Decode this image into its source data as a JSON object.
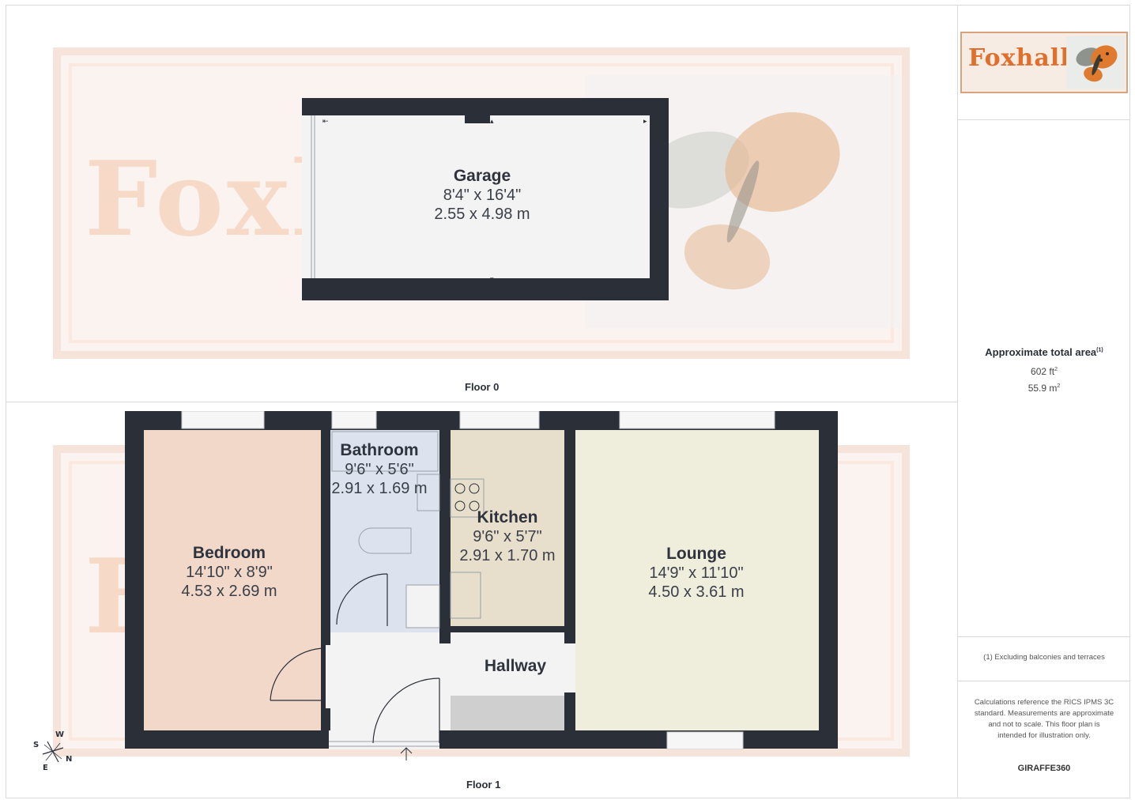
{
  "brand": {
    "logo_text": "Foxhall",
    "watermark_text": "Foxhall",
    "vendor": "GIRAFFE360"
  },
  "colors": {
    "wall": "#2b2f38",
    "bedroom": "#f1d8c8",
    "bathroom": "#dce3ef",
    "kitchen": "#e7dfcb",
    "lounge": "#efeedd",
    "hallway": "#f3f3f3",
    "garage": "#f3f3f3",
    "brand_orange": "#e26e2b"
  },
  "floors": [
    {
      "label": "Floor 0",
      "rooms": [
        {
          "name": "Garage",
          "dim_imperial": "8'4\" x 16'4\"",
          "dim_metric": "2.55 x 4.98 m"
        }
      ]
    },
    {
      "label": "Floor 1",
      "rooms": [
        {
          "name": "Bedroom",
          "dim_imperial": "14'10\" x 8'9\"",
          "dim_metric": "4.53 x 2.69 m"
        },
        {
          "name": "Bathroom",
          "dim_imperial": "9'6\" x 5'6\"",
          "dim_metric": "2.91 x 1.69 m"
        },
        {
          "name": "Kitchen",
          "dim_imperial": "9'6\" x 5'7\"",
          "dim_metric": "2.91 x 1.70 m"
        },
        {
          "name": "Lounge",
          "dim_imperial": "14'9\" x 11'10\"",
          "dim_metric": "4.50 x 3.61 m"
        },
        {
          "name": "Hallway"
        }
      ],
      "compass": {
        "w": "W",
        "s": "S",
        "e": "E",
        "n": "N"
      }
    }
  ],
  "summary": {
    "title": "Approximate total area",
    "title_superscript": "(1)",
    "area_ft": "602 ft",
    "area_ft_unit_sup": "2",
    "area_m": "55.9 m",
    "area_m_unit_sup": "2",
    "footnote": "(1) Excluding balconies and terraces",
    "disclaimer": "Calculations reference the RICS IPMS 3C standard. Measurements are approximate and not to scale. This floor plan is intended for illustration only."
  }
}
